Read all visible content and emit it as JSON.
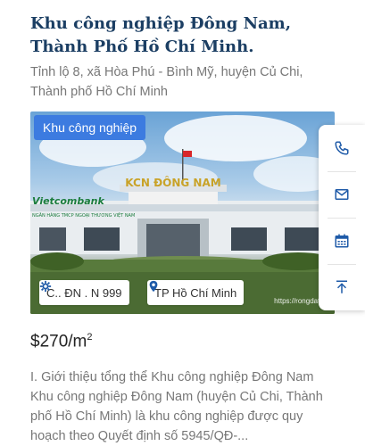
{
  "listing": {
    "title": "Khu công nghiệp Đông Nam, Thành Phố Hồ Chí Minh.",
    "address": "Tỉnh lộ 8, xã Hòa Phú - Bình Mỹ, huyện Củ Chi, Thành phố Hồ Chí Minh",
    "category_badge": "Khu công nghiệp",
    "chip_code": "C.. ĐN . N 999",
    "chip_location": "TP Hồ Chí Minh",
    "image_watermark": "https://rongdat.vn",
    "image_sign_text": "KCN ĐÔNG NAM",
    "image_bank_text": "Vietcombank",
    "image_bank_subtext": "NGÂN HÀNG TMCP NGOẠI THƯƠNG VIỆT NAM",
    "price": "$270/m",
    "price_unit_sup": "2",
    "description": "I. Giới thiệu tổng thể Khu công nghiệp Đông Nam Khu công nghiệp Đông Nam (huyện Củ Chi, Thành phố Hồ Chí Minh) là khu công nghiệp được quy hoạch theo Quyết định số 5945/QĐ-..."
  },
  "sidebar": {
    "items": [
      {
        "icon": "phone-icon"
      },
      {
        "icon": "mail-icon"
      },
      {
        "icon": "calendar-icon"
      },
      {
        "icon": "scroll-top-icon"
      }
    ]
  },
  "colors": {
    "title": "#1b3e63",
    "badge": "#3c7be0",
    "accent_icon": "#1e5aa8",
    "muted_text": "#777777"
  }
}
